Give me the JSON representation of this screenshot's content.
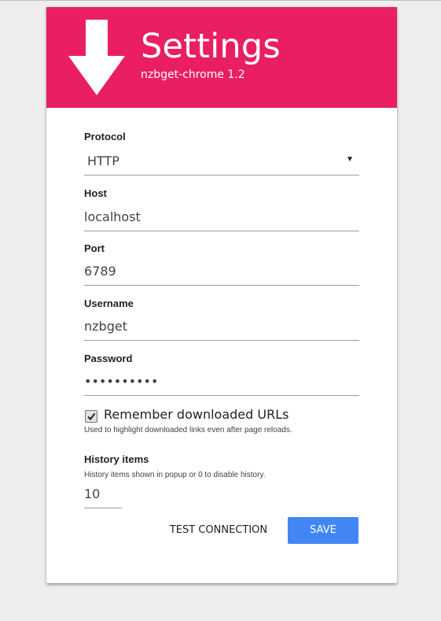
{
  "header": {
    "title": "Settings",
    "subtitle": "nzbget-chrome 1.2",
    "logo_icon": "download-arrow-icon",
    "color": "#e91e63"
  },
  "form": {
    "protocol": {
      "label": "Protocol",
      "value": "HTTP",
      "icon": "dropdown-caret-icon"
    },
    "host": {
      "label": "Host",
      "value": "localhost"
    },
    "port": {
      "label": "Port",
      "value": "6789"
    },
    "username": {
      "label": "Username",
      "value": "nzbget"
    },
    "password": {
      "label": "Password",
      "value": "••••••••••"
    },
    "remember": {
      "label": "Remember downloaded URLs",
      "hint": "Used to highlight downloaded links even after page reloads.",
      "checked": true
    },
    "history": {
      "label": "History items",
      "hint": "History items shown in popup or 0 to disable history.",
      "value": "10"
    }
  },
  "actions": {
    "test_label": "TEST CONNECTION",
    "save_label": "SAVE",
    "save_color": "#4285f4"
  }
}
